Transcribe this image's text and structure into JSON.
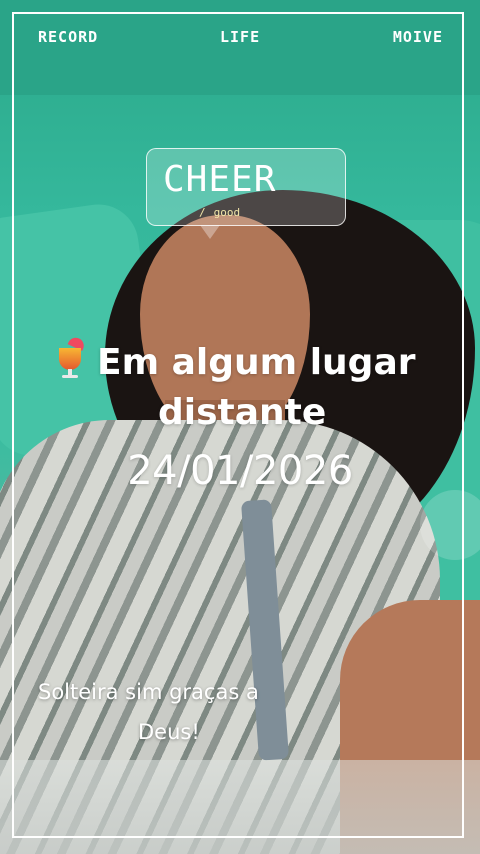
{
  "top_nav": {
    "left": "RECORD",
    "center": "LIFE",
    "right": "MOIVE"
  },
  "sticker": {
    "title": "CHEER",
    "subtitle_slash": "/",
    "subtitle": "good"
  },
  "location": {
    "icon": "tropical-drink-icon",
    "line1": "Em algum lugar",
    "line2": "distante"
  },
  "date": "24/01/2026",
  "caption": {
    "line1": "Solteira sim graças a",
    "line2": "Deus!"
  },
  "colors": {
    "background": "#2fb59a",
    "frame": "#ffffff",
    "text": "#ffffff",
    "sticker_subtitle": "#f1e5a8"
  }
}
